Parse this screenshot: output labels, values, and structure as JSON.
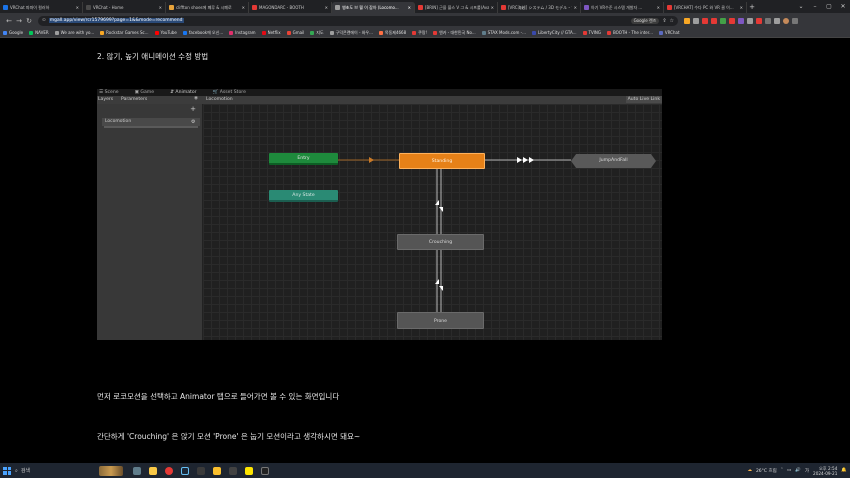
{
  "browser": {
    "tabs": [
      {
        "title": "VRChat 파파이 컬러하",
        "color": "#1a73e8",
        "active": false
      },
      {
        "title": "VRChat - Home",
        "color": "#4a4a4a",
        "active": false
      },
      {
        "title": "cliffton shoes에 폐루 & 시폐로",
        "color": "#e8a33a",
        "active": false
      },
      {
        "title": "MAGONDARC - BOOTH",
        "color": "#e53935",
        "active": false
      },
      {
        "title": "쌩초도 브 뭘 이 잡아 (Locomo...",
        "color": "#9e9e9e",
        "active": true
      },
      {
        "title": "[BRIN] 근을 블스 V 그 & 시프롤(Avatar...",
        "color": "#e53935",
        "active": false
      },
      {
        "title": "[VRC海越] システム / 3D モデル・ア...",
        "color": "#e53935",
        "active": false
      },
      {
        "title": "아기 VR수준 시스템 개발자 ...",
        "color": "#7e57c2",
        "active": false
      },
      {
        "title": "[VRCHAT] 수다 PC 와 VR 클 이...",
        "color": "#e53935",
        "active": false
      }
    ],
    "new_tab": "+",
    "url": "mgall.app/view/rcr1579699?page=1&&mode=recommend",
    "search_badge": "Google 렌즈",
    "window_controls": [
      "⌄",
      "–",
      "▢",
      "✕"
    ]
  },
  "bookmarks": [
    {
      "label": "Google",
      "color": "#4285f4"
    },
    {
      "label": "NAVER",
      "color": "#03c75a"
    },
    {
      "label": "We are with yo...",
      "color": "#9e9e9e"
    },
    {
      "label": "Rockstar Games Sc...",
      "color": "#f9a825"
    },
    {
      "label": "YouTube",
      "color": "#ff0000"
    },
    {
      "label": "facebook에 오신...",
      "color": "#1877f2"
    },
    {
      "label": "Instagram",
      "color": "#e1306c"
    },
    {
      "label": "Netflix",
      "color": "#e50914"
    },
    {
      "label": "Gmail",
      "color": "#ea4335"
    },
    {
      "label": "지도",
      "color": "#34a853"
    },
    {
      "label": "구덕콘랜에이 - 와우...",
      "color": "#9e9e9e"
    },
    {
      "label": "목동제4668",
      "color": "#ff7043"
    },
    {
      "label": "쿠팡!",
      "color": "#e53935"
    },
    {
      "label": "엔카 - 대한민국 No...",
      "color": "#e53935"
    },
    {
      "label": "STAX Mods.com -...",
      "color": "#607d8b"
    },
    {
      "label": "LibertyCity // GTA...",
      "color": "#3949ab"
    },
    {
      "label": "TVING",
      "color": "#e53935"
    },
    {
      "label": "BOOTH - The inter...",
      "color": "#e53935"
    },
    {
      "label": "VRChat",
      "color": "#5c6bc0"
    }
  ],
  "article": {
    "heading": "2. 않기, 높기 애니메이션 수정 방법",
    "para1": "먼저 로코모션을 선택하고 Animator 탭으로 들어가면 볼 수 있는 화면입니다",
    "para2": "간단하게 'Crouching' 은 앉기 모션 'Prone' 은 눕기 모션이라고 생각하시면 돼요~"
  },
  "unity": {
    "tabs": [
      "Scene",
      "Game",
      "Animator",
      "Asset Store"
    ],
    "left_tabs": [
      "Layers",
      "Parameters"
    ],
    "breadcrumb": "Locomotion",
    "live_link": "Auto Live Link",
    "layer_name": "Locomotion",
    "nodes": {
      "entry": "Entry",
      "any_state": "Any State",
      "standing": "Standing",
      "jump": "JumpAndFall",
      "crouching": "Crouching",
      "prone": "Prone"
    }
  },
  "taskbar": {
    "search": "검색",
    "weather": "26°C 흐림",
    "lang": "가",
    "time": "오후 2:54",
    "date": "2024-09-21"
  }
}
